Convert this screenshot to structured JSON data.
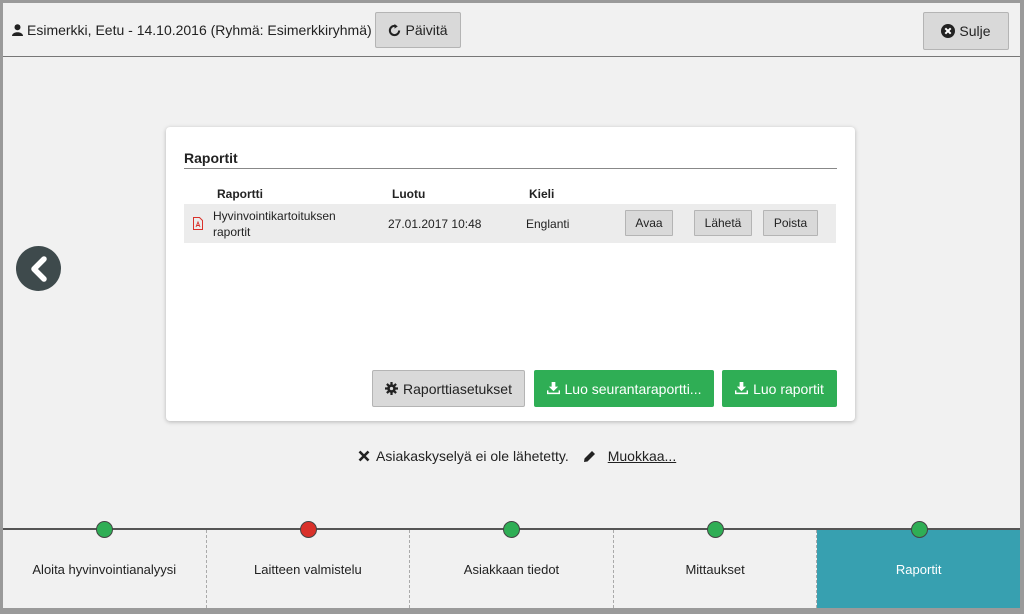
{
  "header": {
    "user_label": "Esimerkki, Eetu - 14.10.2016 (Ryhmä: Esimerkkiryhmä)",
    "refresh_label": "Päivitä",
    "close_label": "Sulje"
  },
  "reports": {
    "title": "Raportit",
    "columns": [
      "Raportti",
      "Luotu",
      "Kieli"
    ],
    "rows": [
      {
        "name": "Hyvinvointikartoituksen raportit",
        "created": "27.01.2017 10:48",
        "language": "Englanti",
        "open_label": "Avaa",
        "send_label": "Lähetä",
        "delete_label": "Poista"
      }
    ],
    "settings_label": "Raporttiasetukset",
    "followup_label": "Luo seurantaraportti...",
    "create_label": "Luo raportit"
  },
  "status": {
    "text": "Asiakaskyselyä ei ole lähetetty.",
    "edit_label": "Muokkaa..."
  },
  "steps": [
    {
      "label": "Aloita hyvinvointianalyysi",
      "status_color": "#2fae55"
    },
    {
      "label": "Laitteen valmistelu",
      "status_color": "#d9312a"
    },
    {
      "label": "Asiakkaan tiedot",
      "status_color": "#2fae55"
    },
    {
      "label": "Mittaukset",
      "status_color": "#2fae55"
    },
    {
      "label": "Raportit",
      "status_color": "#2fae55",
      "active": true
    }
  ],
  "colors": {
    "accent_green": "#2fae55",
    "active_step": "#37a0b0",
    "error_red": "#d9312a"
  }
}
